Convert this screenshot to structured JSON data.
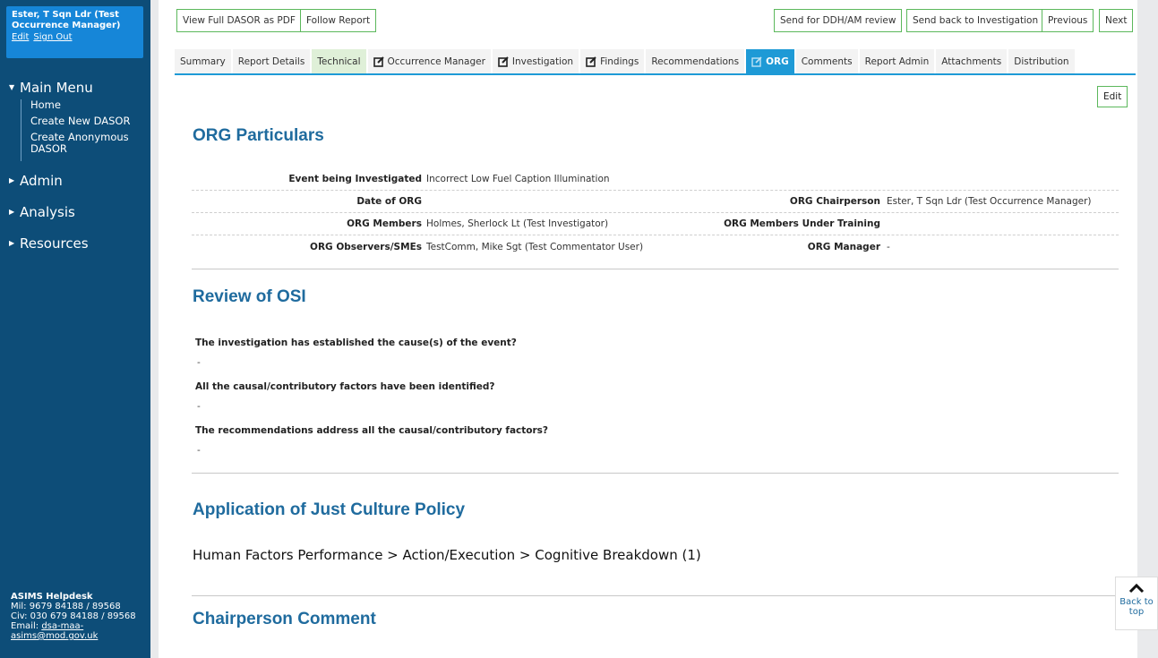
{
  "user": {
    "name": "Ester, T Sqn Ldr (Test Occurrence Manager)",
    "edit_label": "Edit",
    "signout_label": "Sign Out"
  },
  "sidebar": {
    "main_menu": "Main Menu",
    "main_items": [
      "Home",
      "Create New DASOR",
      "Create Anonymous DASOR"
    ],
    "admin": "Admin",
    "analysis": "Analysis",
    "resources": "Resources",
    "helpdesk": {
      "title": "ASIMS Helpdesk",
      "mil": "Mil: 9679 84188 / 89568",
      "civ": "Civ: 030 679 84188 / 89568",
      "email_label": "Email:",
      "email": "dsa-maa-asims@mod.gov.uk"
    }
  },
  "toolbar": {
    "view_pdf": "View Full DASOR as PDF",
    "follow": "Follow Report",
    "send_ddh": "Send for DDH/AM review",
    "send_back": "Send back to Investigation",
    "previous": "Previous",
    "next": "Next"
  },
  "tabs": [
    "Summary",
    "Report Details",
    "Technical",
    "Occurrence Manager",
    "Investigation",
    "Findings",
    "Recommendations",
    "ORG",
    "Comments",
    "Report Admin",
    "Attachments",
    "Distribution"
  ],
  "edit_label": "Edit",
  "particulars": {
    "title": "ORG Particulars",
    "event_label": "Event being Investigated",
    "event_value": "Incorrect Low Fuel Caption Illumination",
    "date_label": "Date of ORG",
    "date_value": "",
    "chair_label": "ORG Chairperson",
    "chair_value": "Ester, T Sqn Ldr (Test Occurrence Manager)",
    "members_label": "ORG Members",
    "members_value": "Holmes, Sherlock Lt (Test Investigator)",
    "training_label": "ORG Members Under Training",
    "training_value": "",
    "observers_label": "ORG Observers/SMEs",
    "observers_value": "TestComm, Mike Sgt (Test Commentator User)",
    "manager_label": "ORG Manager",
    "manager_value": "-"
  },
  "review": {
    "title": "Review of OSI",
    "q1": "The investigation has established the cause(s) of the event?",
    "a1": "-",
    "q2": "All the causal/contributory factors have been identified?",
    "a2": "-",
    "q3": "The recommendations address all the causal/contributory factors?",
    "a3": "-"
  },
  "just_culture": {
    "title": "Application of Just Culture Policy",
    "text": "Human Factors Performance > Action/Execution > Cognitive Breakdown (1)"
  },
  "chair_comment": {
    "title": "Chairperson Comment"
  },
  "back_to_top": "Back to top"
}
